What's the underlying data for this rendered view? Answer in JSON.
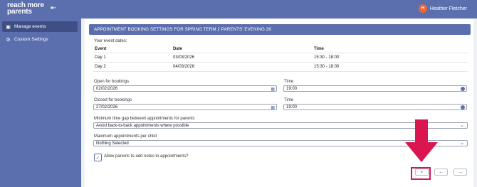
{
  "brand": {
    "line1": "reach more",
    "line2": "parents"
  },
  "user": {
    "initial": "H",
    "name": "Heather Fletcher"
  },
  "sidebar": {
    "items": [
      {
        "label": "Manage events"
      },
      {
        "label": "Custom Settings"
      }
    ]
  },
  "panel": {
    "title": "APPOINTMENT BOOKING SETTINGS FOR SPRING TERM 2 PARENTS' EVENING 26",
    "event_dates_label": "Your event dates:",
    "columns": [
      "Event",
      "Date",
      "Time"
    ],
    "rows": [
      {
        "event": "Day 1",
        "date": "03/03/2026",
        "time": "15:30 - 18:00"
      },
      {
        "event": "Day 2",
        "date": "04/03/2026",
        "time": "15:30 - 18:00"
      }
    ],
    "open": {
      "label": "Open for bookings",
      "value": "02/02/2026",
      "time_label": "Time",
      "time": "19:00"
    },
    "closed": {
      "label": "Closed for bookings",
      "value": "27/02/2026",
      "time_label": "Time",
      "time": "19:00"
    },
    "gap": {
      "label": "Minimum time gap between appointments for parents",
      "value": "Avoid back-to-back appointments where possible"
    },
    "max": {
      "label": "Maximum appointments per child",
      "value": "Nothing Selected"
    },
    "notes": {
      "label": "Allow parents to add notes to appointments?",
      "checked": true
    }
  },
  "icons": {
    "collapse": "collapse-sidebar-icon",
    "calendar": "calendar-icon",
    "clock": "clock-icon",
    "save": "save-icon",
    "back": "arrow-left-icon",
    "next": "arrow-right-icon"
  },
  "colors": {
    "primary": "#5b6fae",
    "highlight": "#d9164f",
    "save": "#2e9e4f",
    "avatar": "#e8673a"
  }
}
